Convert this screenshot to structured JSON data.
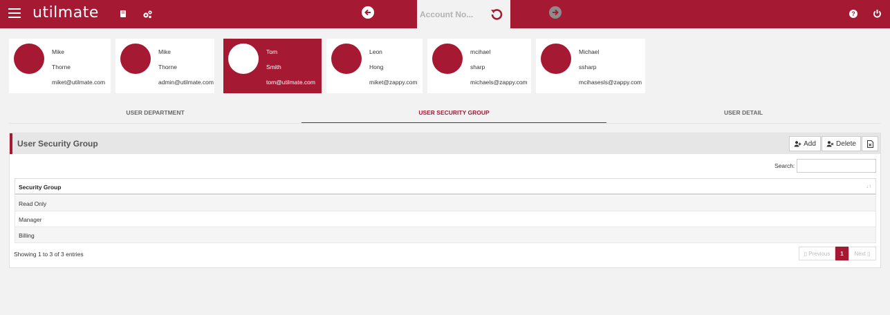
{
  "header": {
    "brand": "utilmate",
    "account_placeholder": "Account No...",
    "help_glyph": "?"
  },
  "users": [
    {
      "first": "Mike",
      "last": "Thorne",
      "email": "miket@utilmate.com",
      "active": false
    },
    {
      "first": "Mike",
      "last": "Thorne",
      "email": "admin@utilmate.com",
      "active": false
    },
    {
      "first": "Tom",
      "last": "Smith",
      "email": "tom@utilmate.com",
      "active": true
    },
    {
      "first": "Leon",
      "last": "Hong",
      "email": "miket@zappy.com",
      "active": false
    },
    {
      "first": "mcihael",
      "last": "sharp",
      "email": "michaels@zappy.com",
      "active": false
    },
    {
      "first": "Michael",
      "last": "ssharp",
      "email": "mcihasesls@zappy.com",
      "active": false
    }
  ],
  "tabs": [
    {
      "label": "USER DEPARTMENT",
      "active": false
    },
    {
      "label": "USER SECURITY GROUP",
      "active": true
    },
    {
      "label": "USER DETAIL",
      "active": false
    }
  ],
  "panel": {
    "title": "User Security Group",
    "add_label": "Add",
    "delete_label": "Delete",
    "search_label": "Search:",
    "column_header": "Security Group",
    "rows": [
      "Read Only",
      "Manager",
      "Billing"
    ],
    "info": "Showing 1 to 3 of 3 entries",
    "prev_label": "Previous",
    "page": "1",
    "next_label": "Next"
  },
  "colors": {
    "brand": "#a51932",
    "background": "#f2f2f2"
  }
}
